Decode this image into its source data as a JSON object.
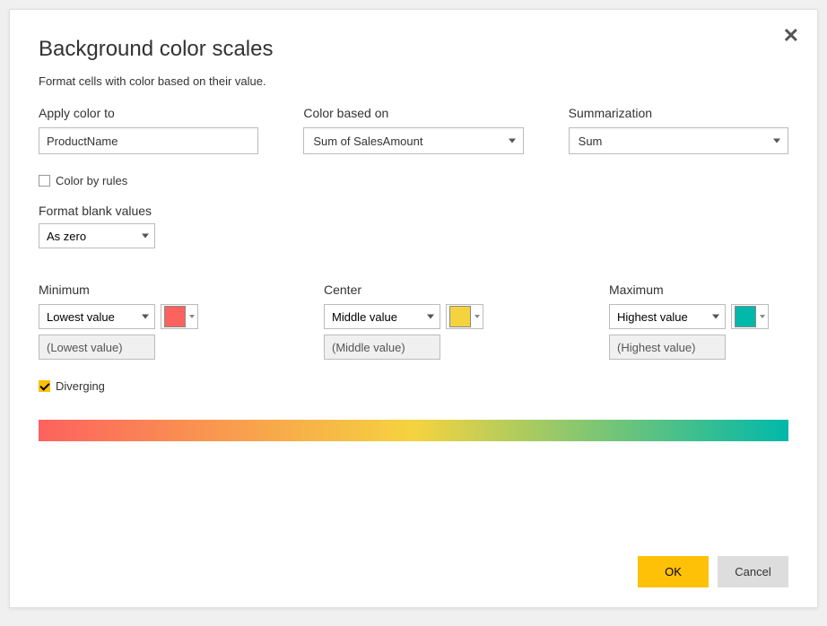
{
  "dialog": {
    "title": "Background color scales",
    "subtitle": "Format cells with color based on their value."
  },
  "top": {
    "applyColorTo": {
      "label": "Apply color to",
      "value": "ProductName"
    },
    "colorBasedOn": {
      "label": "Color based on",
      "value": "Sum of SalesAmount"
    },
    "summarization": {
      "label": "Summarization",
      "value": "Sum"
    }
  },
  "colorByRules": {
    "label": "Color by rules",
    "checked": false
  },
  "formatBlank": {
    "label": "Format blank values",
    "value": "As zero"
  },
  "minimum": {
    "label": "Minimum",
    "mode": "Lowest value",
    "display": "(Lowest value)",
    "color": "#fd625e"
  },
  "center": {
    "label": "Center",
    "mode": "Middle value",
    "display": "(Middle value)",
    "color": "#f5d33f"
  },
  "maximum": {
    "label": "Maximum",
    "mode": "Highest value",
    "display": "(Highest value)",
    "color": "#01b8aa"
  },
  "diverging": {
    "label": "Diverging",
    "checked": true
  },
  "buttons": {
    "ok": "OK",
    "cancel": "Cancel"
  }
}
